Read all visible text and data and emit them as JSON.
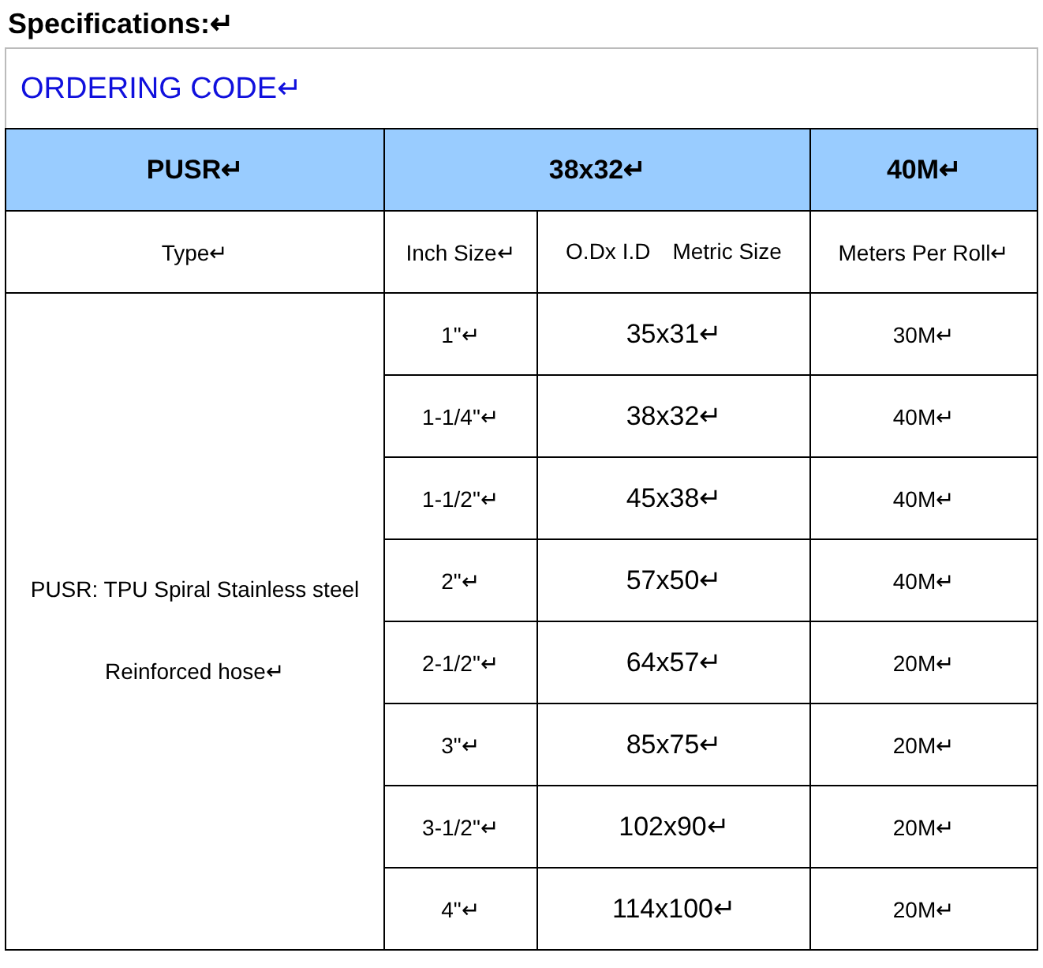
{
  "heading": "Specifications:↵",
  "ordering_code": "ORDERING CODE↵",
  "code_row": [
    "PUSR↵",
    "38x32↵",
    "40M↵"
  ],
  "columns": [
    "Type↵",
    "Inch Size↵",
    "O.Dx I.D　Metric Size",
    "Meters Per Roll↵"
  ],
  "type_lines": [
    "PUSR: TPU Spiral Stainless steel",
    "Reinforced hose↵"
  ],
  "rows": [
    {
      "inch": "1\"↵",
      "metric": "35x31↵",
      "meters": "30M↵"
    },
    {
      "inch": "1-1/4\"↵",
      "metric": "38x32↵",
      "meters": "40M↵"
    },
    {
      "inch": "1-1/2\"↵",
      "metric": "45x38↵",
      "meters": "40M↵"
    },
    {
      "inch": "2\"↵",
      "metric": "57x50↵",
      "meters": "40M↵"
    },
    {
      "inch": "2-1/2\"↵",
      "metric": "64x57↵",
      "meters": "20M↵"
    },
    {
      "inch": "3\"↵",
      "metric": "85x75↵",
      "meters": "20M↵"
    },
    {
      "inch": "3-1/2\"↵",
      "metric": "102x90↵",
      "meters": "20M↵"
    },
    {
      "inch": "4\"↵",
      "metric": "114x100↵",
      "meters": "20M↵"
    }
  ]
}
